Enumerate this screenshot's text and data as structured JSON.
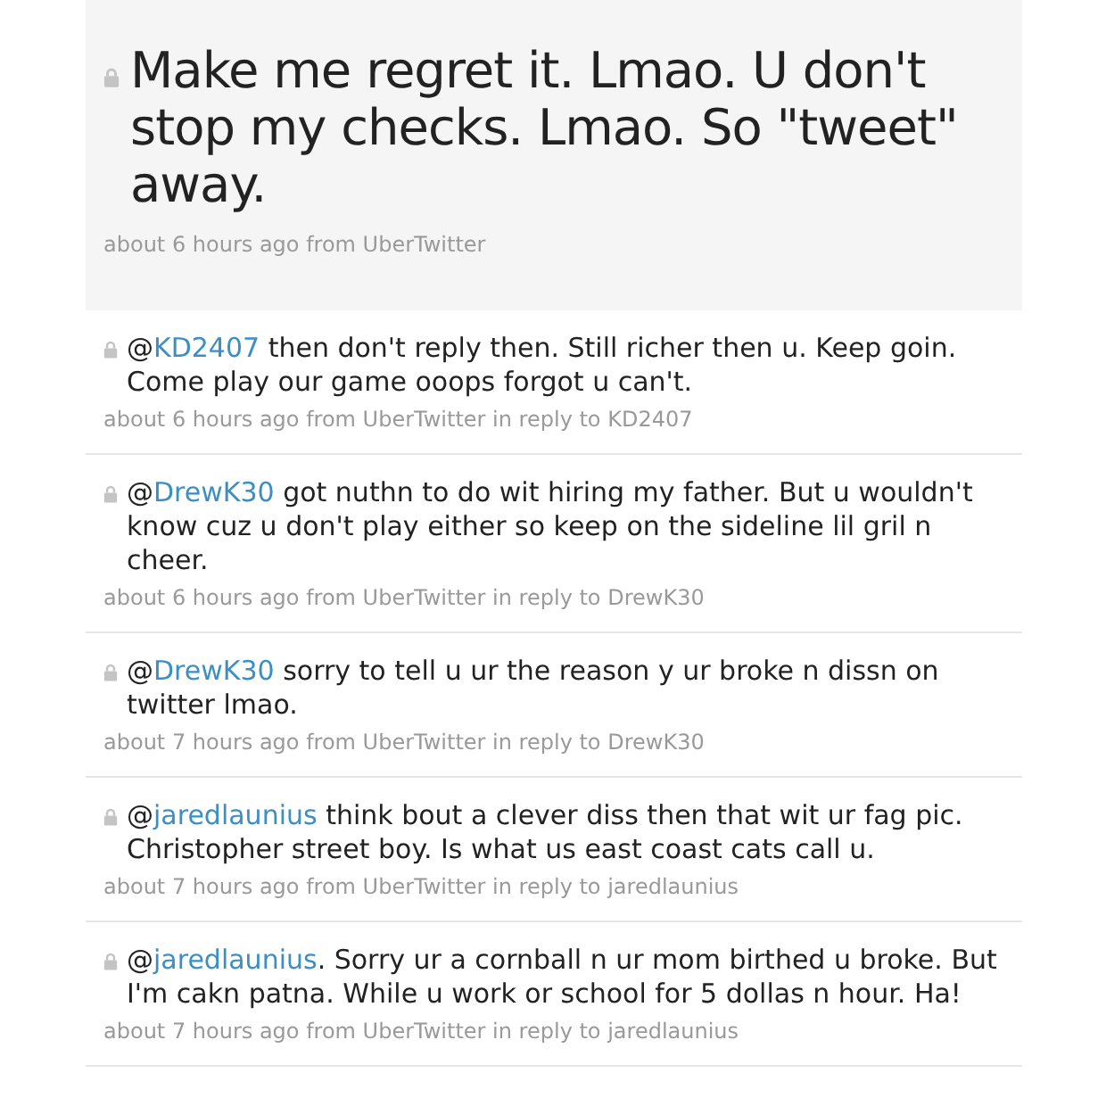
{
  "featured_tweet": {
    "text": "Make me regret it. Lmao. U don't stop my checks. Lmao. So \"tweet\" away.",
    "meta": "about 6 hours ago from UberTwitter"
  },
  "tweets": [
    {
      "at": "@",
      "mention": "KD2407",
      "text": " then don't reply then. Still richer then u. Keep goin. Come play our game ooops forgot u can't.",
      "meta": "about 6 hours ago from UberTwitter in reply to KD2407"
    },
    {
      "at": "@",
      "mention": "DrewK30",
      "text": " got nuthn to do wit hiring my father. But u wouldn't know cuz u don't play either so keep on the sideline lil gril n cheer.",
      "meta": "about 6 hours ago from UberTwitter in reply to DrewK30"
    },
    {
      "at": "@",
      "mention": "DrewK30",
      "text": " sorry to tell u ur the reason y ur broke n dissn on twitter lmao.",
      "meta": "about 7 hours ago from UberTwitter in reply to DrewK30"
    },
    {
      "at": "@",
      "mention": "jaredlaunius",
      "text": " think bout a clever diss then that wit ur fag pic. Christopher street boy. Is what us east coast cats call u.",
      "meta": "about 7 hours ago from UberTwitter in reply to jaredlaunius"
    },
    {
      "at": "@",
      "mention": "jaredlaunius",
      "text": ". Sorry ur a cornball n ur mom birthed u broke. But I'm cakn patna. While u work or school for 5 dollas n hour. Ha!",
      "meta": "about 7 hours ago from UberTwitter in reply to jaredlaunius"
    }
  ]
}
